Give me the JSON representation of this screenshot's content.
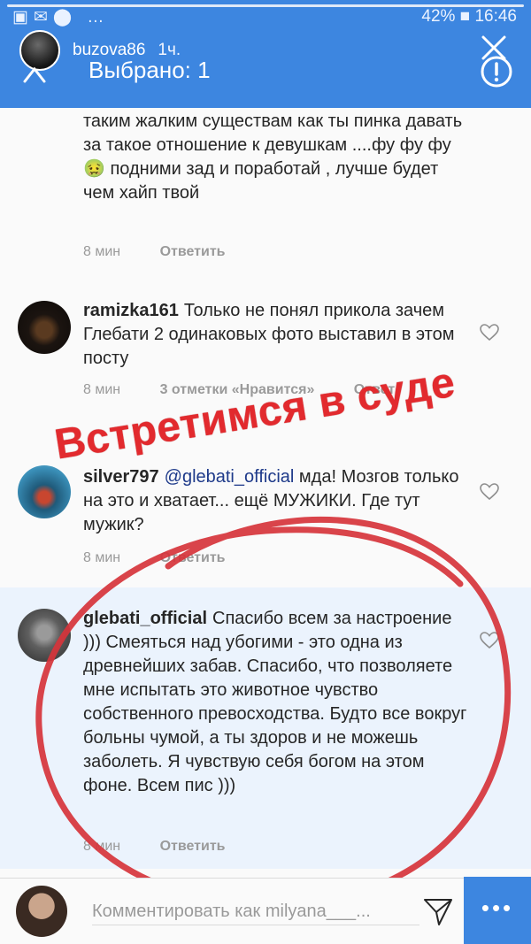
{
  "story": {
    "username": "buzova86",
    "time": "1ч.",
    "sticker_text": "Встретимся в суде"
  },
  "statusbar": {
    "right_text": "42% ■ 16:46"
  },
  "toolbar": {
    "title": "Выбрано: 1"
  },
  "comments": [
    {
      "username": "",
      "text": "таким жалким существам как ты пинка давать за такое отношение к девушкам ....фу фу фу 🤢 подними зад и поработай , лучше будет чем хайп твой",
      "time": "8 мин",
      "likes": "",
      "reply": "Ответить"
    },
    {
      "username": "ramizka161",
      "text": "Только не понял прикола зачем Глебати 2 одинаковых фото выставил в этом посту",
      "time": "8 мин",
      "likes": "3 отметки «Нравится»",
      "reply": "Ответ"
    },
    {
      "username": "silver797",
      "mention": "@glebati_official",
      "text": "мда! Мозгов только на это и хватает... ещё МУЖИКИ. Где тут мужик?",
      "time": "8 мин",
      "likes": "",
      "reply": "Ответить"
    },
    {
      "username": "glebati_official",
      "text": "Спасибо всем за настроение ))) Смеяться над убогими - это одна из древнейших забав. Спасибо, что позволяете мне испытать это животное чувство собственного превосходства. Будто все вокруг больны чумой, а ты здоров и не можешь заболеть. Я чувствую себя богом на этом фоне. Всем пис )))",
      "time": "8 мин",
      "likes": "",
      "reply": "Ответить"
    }
  ],
  "bottom": {
    "comment_placeholder": "Комментировать как milyana___..."
  },
  "colors": {
    "accent": "#3d86e0",
    "highlight": "#ebf3fd",
    "sticker": "#e22a2e"
  }
}
